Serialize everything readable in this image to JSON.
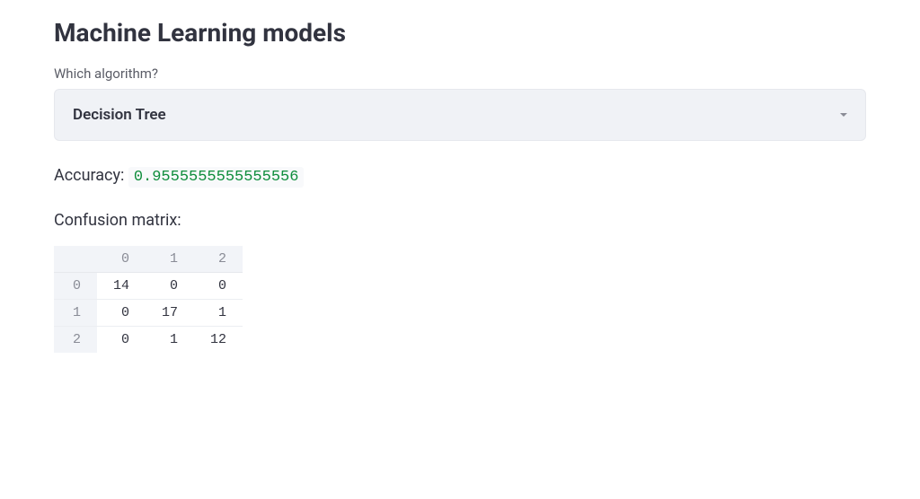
{
  "title": "Machine Learning models",
  "algorithm": {
    "label": "Which algorithm?",
    "selected": "Decision Tree"
  },
  "accuracy": {
    "label": "Accuracy: ",
    "value": "0.9555555555555556"
  },
  "confusion_matrix": {
    "label": "Confusion matrix:",
    "headers": [
      "0",
      "1",
      "2"
    ],
    "rows": [
      {
        "label": "0",
        "cells": [
          "14",
          "0",
          "0"
        ]
      },
      {
        "label": "1",
        "cells": [
          "0",
          "17",
          "1"
        ]
      },
      {
        "label": "2",
        "cells": [
          "0",
          "1",
          "12"
        ]
      }
    ]
  }
}
